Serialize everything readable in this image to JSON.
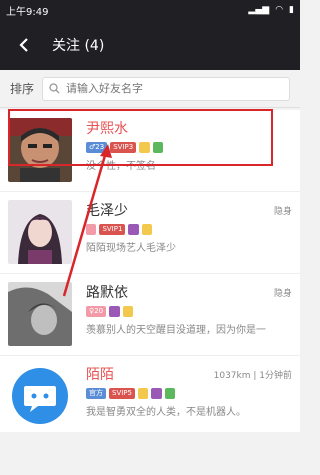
{
  "status": {
    "time": "上午9:49",
    "icons": [
      "signal-icon",
      "wifi-icon",
      "battery-icon"
    ]
  },
  "nav": {
    "title": "关注 (4)"
  },
  "search": {
    "sort_label": "排序",
    "placeholder": "请输入好友名字"
  },
  "contacts": [
    {
      "name": "尹熙水",
      "badges": [
        "♂23",
        "SVIP3",
        "",
        ""
      ],
      "meta": "",
      "signature": "没个性，不签名"
    },
    {
      "name": "毛泽少",
      "badges": [
        "",
        "SVIP1",
        "",
        ""
      ],
      "meta": "隐身",
      "signature": "陌陌现场艺人毛泽少"
    },
    {
      "name": "路默依",
      "badges": [
        "♀20",
        "",
        ""
      ],
      "meta": "隐身",
      "signature": "羡慕别人的天空醒目没道理，因为你是一"
    },
    {
      "name": "陌陌",
      "badges": [
        "官方",
        "SVIP5",
        "",
        "",
        ""
      ],
      "meta": "1037km | 1分钟前",
      "signature": "我是智勇双全的人类，不是机器人。"
    }
  ],
  "colors": {
    "header_bg": "#1f1f24",
    "highlight": "#d9262b",
    "name_red": "#e85353"
  }
}
